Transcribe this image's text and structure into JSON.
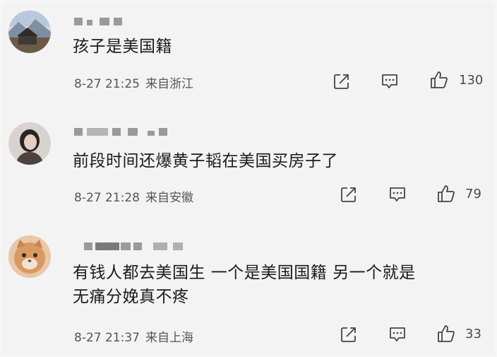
{
  "comments": [
    {
      "text_line1": "孩子是美国籍",
      "text_line2": "",
      "date": "8-27 21:25",
      "location": "来自浙江",
      "likes": "130",
      "avatar_icon": "mountain-landscape-avatar"
    },
    {
      "text_line1": "前段时间还爆黄子韬在美国买房子了",
      "text_line2": "",
      "date": "8-27 21:28",
      "location": "来自安徽",
      "likes": "79",
      "avatar_icon": "person-portrait-avatar"
    },
    {
      "text_line1": "有钱人都去美国生 一个是美国国籍 另一个就是",
      "text_line2": "无痛分娩真不疼",
      "date": "8-27 21:37",
      "location": "来自上海",
      "likes": "33",
      "avatar_icon": "cat-avatar"
    }
  ],
  "icons": {
    "share": "share-icon",
    "comment": "comment-icon",
    "like": "thumbs-up-icon"
  },
  "colors": {
    "background": "#f3f3f4",
    "text": "#1b1b1b",
    "meta": "#555555",
    "icon": "#444444"
  }
}
